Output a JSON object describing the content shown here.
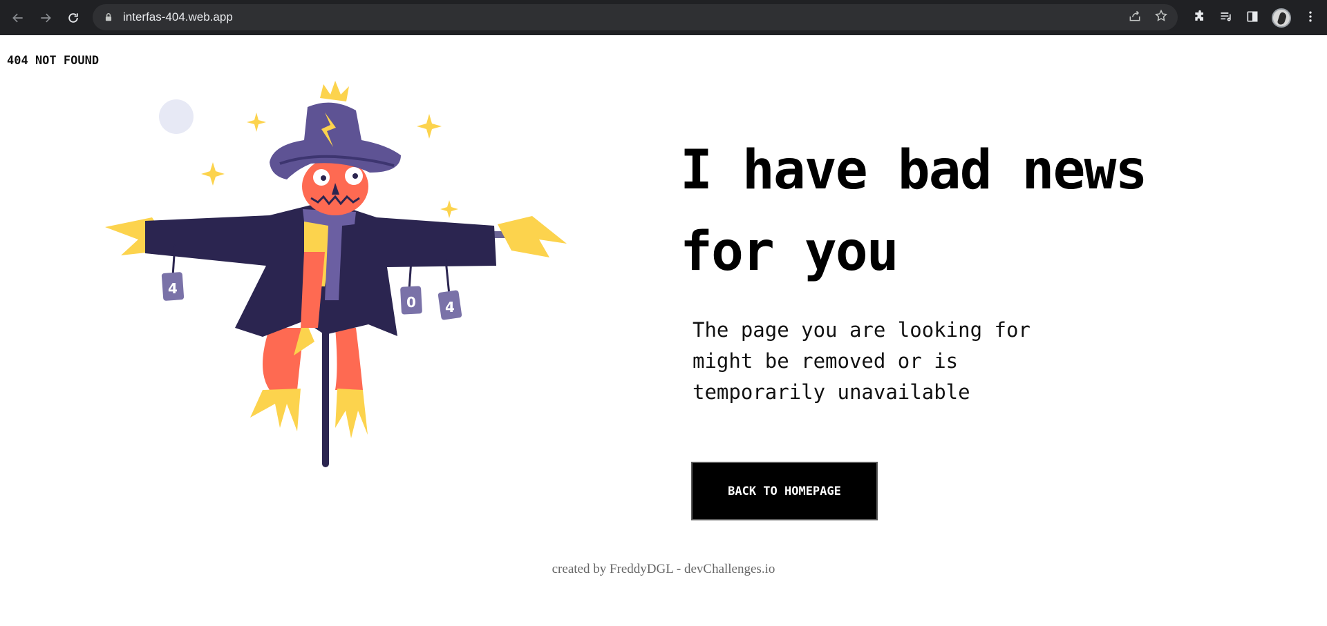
{
  "browser": {
    "url": "interfas-404.web.app"
  },
  "page": {
    "brand": "404 NOT FOUND",
    "headline": "I have bad news for you",
    "subtext": "The page you are looking for might be removed or is temporarily unavailable",
    "cta_label": "BACK TO HOMEPAGE",
    "footer": "created by FreddyDGL - devChallenges.io"
  },
  "illustration": {
    "cans": [
      "4",
      "0",
      "4"
    ]
  },
  "colors": {
    "chrome_bg": "#202124",
    "omnibox_bg": "#2f3033",
    "coat": "#2b2550",
    "hat": "#5e5394",
    "face": "#fe6a52",
    "straw": "#fcd34d",
    "can": "#7a72a8"
  }
}
